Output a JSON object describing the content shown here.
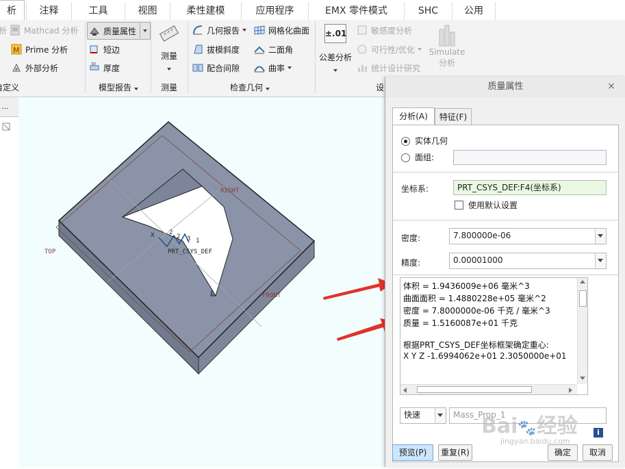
{
  "tabs": [
    "析",
    "注释",
    "工具",
    "视图",
    "柔性建模",
    "应用程序",
    "EMX 零件模式",
    "SHC",
    "公用"
  ],
  "ribbon": {
    "group1": {
      "mathcad": "Mathcad 分析",
      "prime": "Prime 分析",
      "external": "外部分析",
      "label": "自定义"
    },
    "group2": {
      "mass_props": "质量属性",
      "short_edge": "短边",
      "thickness": "厚度",
      "label": "模型报告"
    },
    "group3": {
      "measure": "测量",
      "label": "测量"
    },
    "group4": {
      "geom_report": "几何报告",
      "mesh_surface": "网格化曲面",
      "draft": "拔模斜度",
      "dihedral": "二面角",
      "clearance": "配合间隙",
      "curvature": "曲率",
      "label": "检查几何"
    },
    "group5": {
      "tolerance_value": "±.01",
      "tolerance": "公差分析",
      "sensitivity": "敏感度分析",
      "feasibility": "可行性/优化",
      "stats": "统计设计研究",
      "simulate_line1": "Simulate",
      "simulate_line2": "分析",
      "label": "设"
    }
  },
  "canvas": {
    "leftstrip_text": "...",
    "labels": {
      "right": "RIGHT",
      "top": "TOP",
      "front": "FRONT",
      "csys": "PRT_CSYS_DEF",
      "x": "X",
      "n2a": "2",
      "n2b": "2",
      "n3": "3",
      "n1": "1"
    }
  },
  "dialog": {
    "title": "质量属性",
    "tabs": [
      "分析(A)",
      "特征(F)"
    ],
    "solid_label": "实体几何",
    "quilt_label": "面组:",
    "csys_label": "坐标系:",
    "csys_value": "PRT_CSYS_DEF:F4(坐标系)",
    "use_default": "使用默认设置",
    "density_label": "密度:",
    "density_value": "7.800000e-06",
    "precision_label": "精度:",
    "precision_value": "0.00001000",
    "results": [
      "体积 =  1.9436009e+06  毫米^3",
      "曲面面积 =  1.4880228e+05  毫米^2",
      "密度 =  7.8000000e-06 千克 / 毫米^3",
      "质量 =  1.5160087e+01 千克",
      "",
      "根据PRT_CSYS_DEF坐标框架确定重心:",
      "X   Y   Z    -1.6994062e+01  2.3050000e+01"
    ],
    "mode_value": "快速",
    "name_placeholder": "Mass_Prop_1",
    "preview": "预览(P)",
    "repeat": "重复(R)",
    "ok": "确定",
    "cancel": "取消"
  },
  "watermark": {
    "line1": "Bai",
    "line2": "经验",
    "url": "jingyan.baidu.com"
  },
  "colors": {
    "accent": "#3c8fd6",
    "part_top": "#8a93a7",
    "part_side": "#727b8e",
    "arrow": "#e0332b",
    "csys_field": "#e9f8e3",
    "canvas_bg": "#f2fdfd"
  }
}
